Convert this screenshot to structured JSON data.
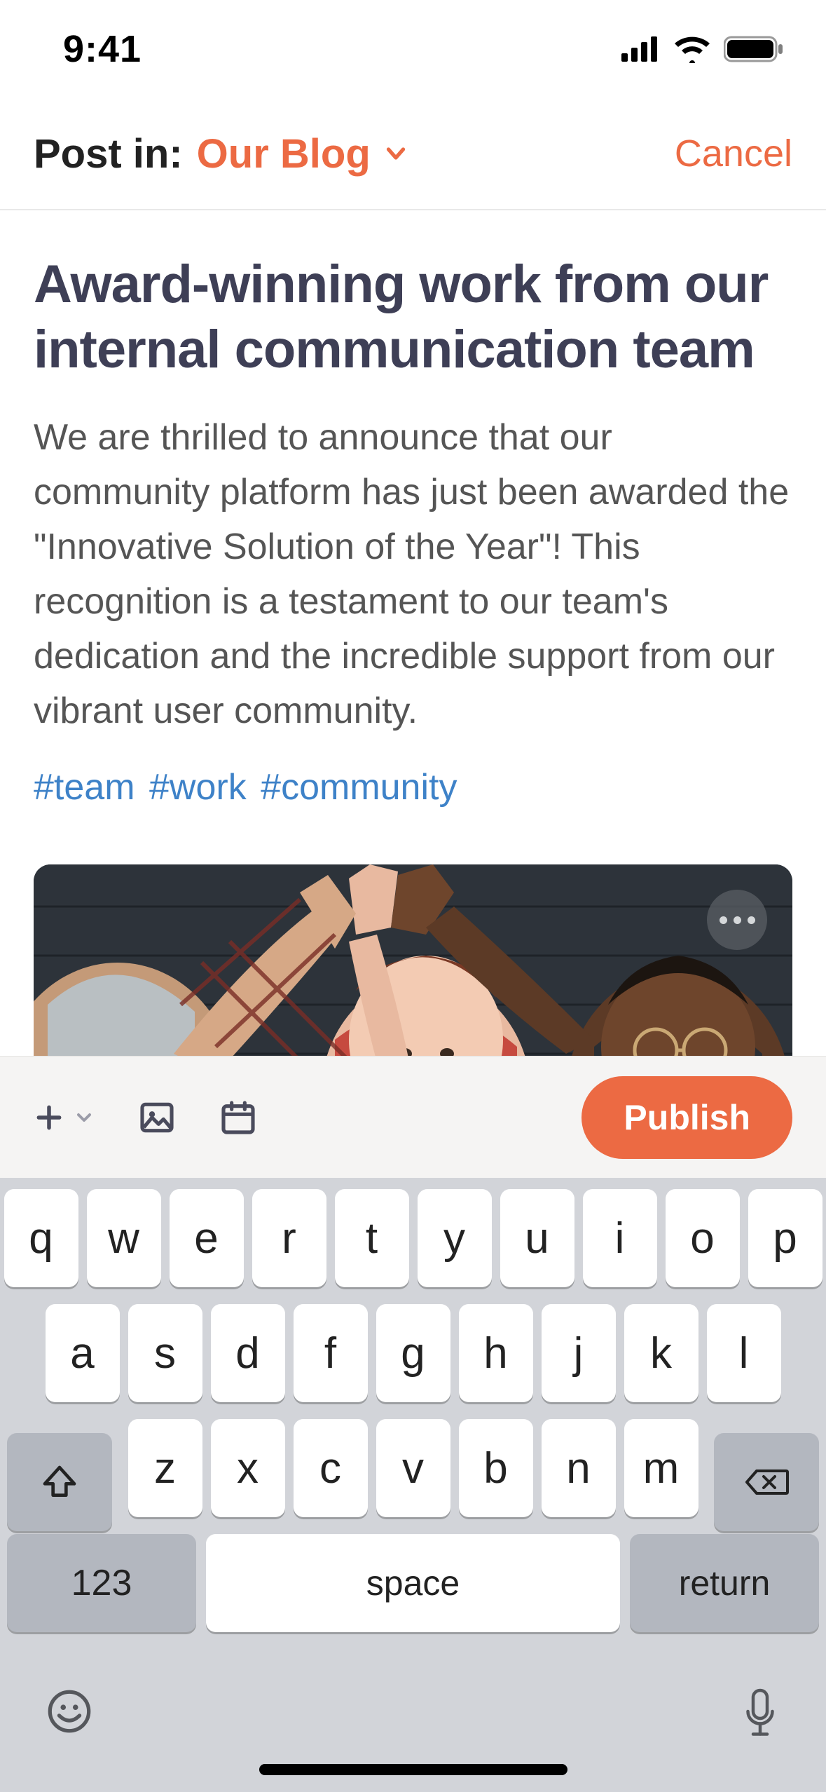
{
  "status": {
    "time": "9:41"
  },
  "header": {
    "post_in_label": "Post in:",
    "destination": "Our Blog",
    "cancel": "Cancel"
  },
  "post": {
    "title": "Award-winning work from our internal communication team",
    "body": "We are thrilled to announce that our community platform has just been awarded the \"Innovative Solution of the Year\"! This recognition is a testament to our team's dedication and the incredible support from our vibrant user community.",
    "hashtags": [
      "#team",
      "#work",
      "#community"
    ]
  },
  "toolbar": {
    "publish": "Publish"
  },
  "keyboard": {
    "row1": [
      "q",
      "w",
      "e",
      "r",
      "t",
      "y",
      "u",
      "i",
      "o",
      "p"
    ],
    "row2": [
      "a",
      "s",
      "d",
      "f",
      "g",
      "h",
      "j",
      "k",
      "l"
    ],
    "row3": [
      "z",
      "x",
      "c",
      "v",
      "b",
      "n",
      "m"
    ],
    "num": "123",
    "space": "space",
    "return": "return"
  }
}
